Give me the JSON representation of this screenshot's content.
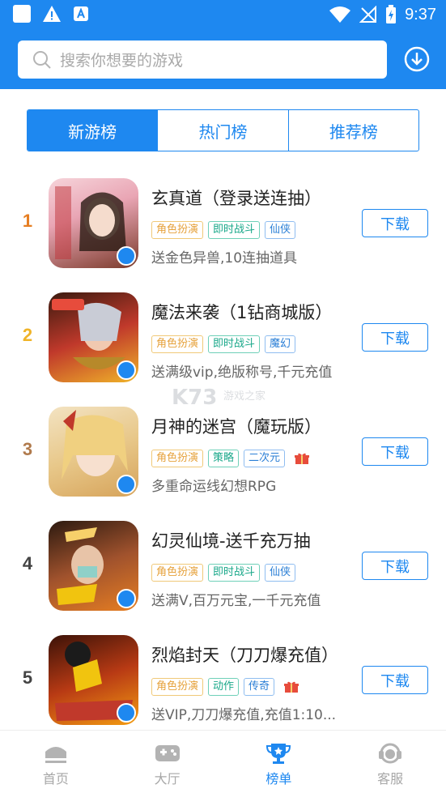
{
  "status_bar": {
    "time": "9:37"
  },
  "search": {
    "placeholder": "搜索你想要的游戏"
  },
  "tabs": [
    {
      "label": "新游榜",
      "active": true
    },
    {
      "label": "热门榜",
      "active": false
    },
    {
      "label": "推荐榜",
      "active": false
    }
  ],
  "games": [
    {
      "rank": "1",
      "rank_color": "#e67e22",
      "title": "玄真道（登录送连抽）",
      "tags": [
        "角色扮演",
        "即时战斗",
        "仙侠"
      ],
      "gift": false,
      "desc": "送金色异兽,10连抽道具",
      "button": "下载"
    },
    {
      "rank": "2",
      "rank_color": "#f0b429",
      "title": "魔法来袭（1钻商城版）",
      "tags": [
        "角色扮演",
        "即时战斗",
        "魔幻"
      ],
      "gift": false,
      "desc": "送满级vip,绝版称号,千元充值",
      "button": "下载"
    },
    {
      "rank": "3",
      "rank_color": "#b07a4c",
      "title": "月神的迷宫（魔玩版）",
      "tags": [
        "角色扮演",
        "策略",
        "二次元"
      ],
      "gift": true,
      "desc": "多重命运线幻想RPG",
      "button": "下载"
    },
    {
      "rank": "4",
      "rank_color": "#444444",
      "title": "幻灵仙境-送千充万抽",
      "tags": [
        "角色扮演",
        "即时战斗",
        "仙侠"
      ],
      "gift": false,
      "desc": "送满V,百万元宝,一千元充值",
      "button": "下载"
    },
    {
      "rank": "5",
      "rank_color": "#444444",
      "title": "烈焰封天（刀刀爆充值）",
      "tags": [
        "角色扮演",
        "动作",
        "传奇"
      ],
      "gift": true,
      "desc": "送VIP,刀刀爆充值,充值1:10...",
      "button": "下载"
    }
  ],
  "watermark": "K73 游戏之家",
  "bottom_nav": [
    {
      "label": "首页",
      "icon": "home-icon",
      "active": false
    },
    {
      "label": "大厅",
      "icon": "gamepad-icon",
      "active": false
    },
    {
      "label": "榜单",
      "icon": "trophy-icon",
      "active": true
    },
    {
      "label": "客服",
      "icon": "headset-icon",
      "active": false
    }
  ],
  "colors": {
    "primary": "#1e88f0"
  }
}
